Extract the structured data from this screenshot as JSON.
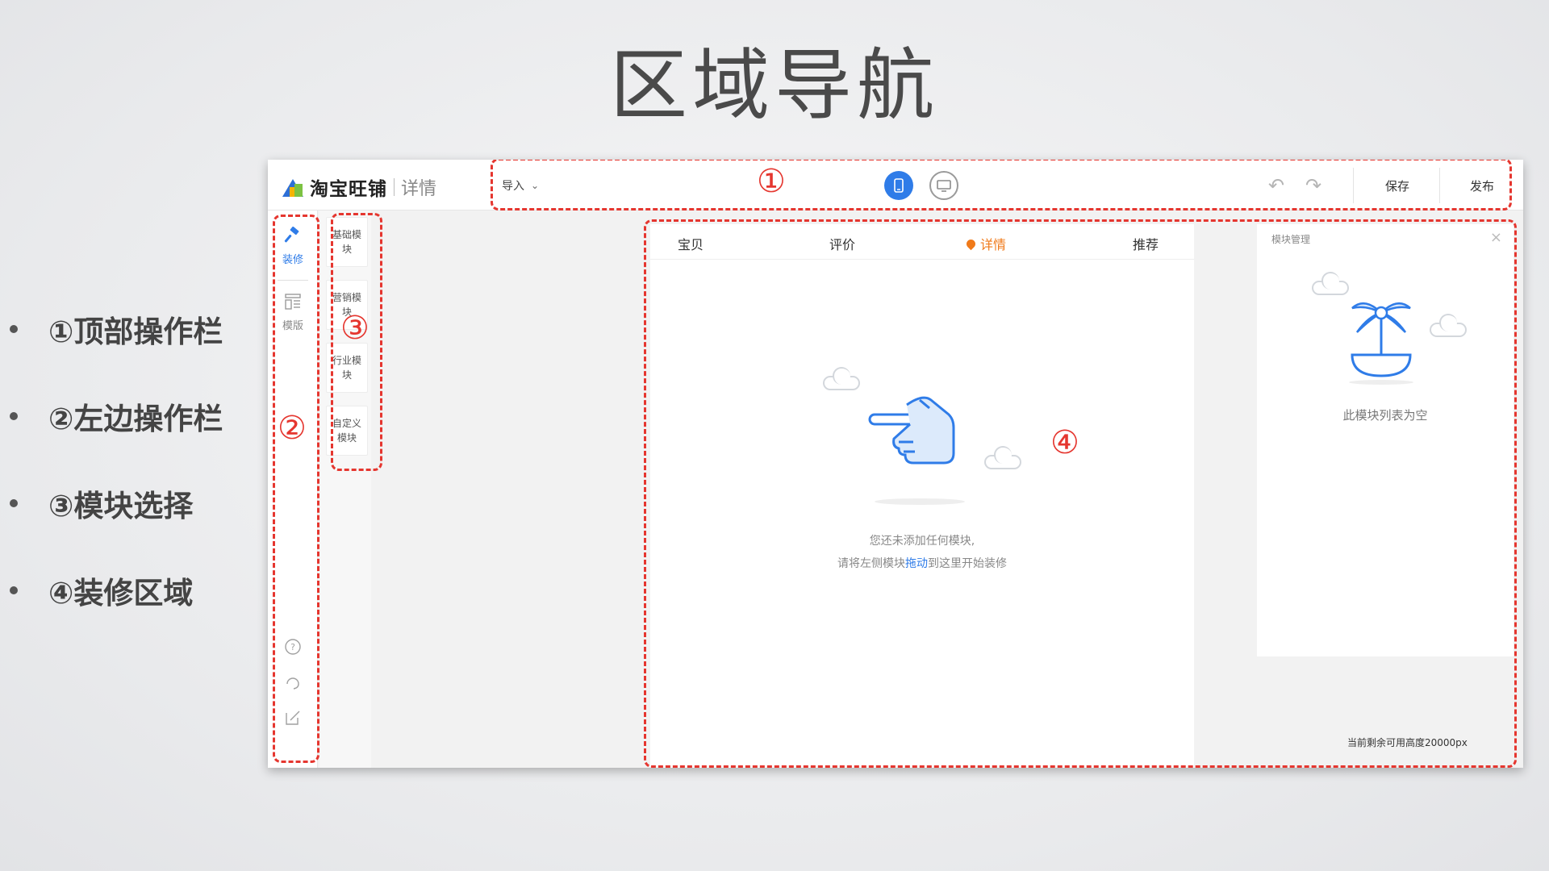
{
  "slide": {
    "title": "区域导航",
    "bullets": [
      "①顶部操作栏",
      "②左边操作栏",
      "③模块选择",
      "④装修区域"
    ]
  },
  "topbar": {
    "logo_text": "淘宝旺铺",
    "logo_sub": "详情",
    "import_label": "导入",
    "save_label": "保存",
    "publish_label": "发布"
  },
  "leftnav": {
    "decorate_label": "装修",
    "template_label": "模版"
  },
  "modules": [
    {
      "label": "基础模块"
    },
    {
      "label": "营销模块"
    },
    {
      "label": "行业模块"
    },
    {
      "label": "自定义模块"
    }
  ],
  "page_tabs": [
    {
      "label": "宝贝"
    },
    {
      "label": "评价"
    },
    {
      "label": "详情"
    },
    {
      "label": "推荐"
    }
  ],
  "canvas": {
    "empty_line1": "您还未添加任何模块,",
    "empty_line2_pre": "请将左侧模块",
    "empty_line2_link": "拖动",
    "empty_line2_post": "到这里开始装修"
  },
  "panel": {
    "title": "模块管理",
    "empty_text": "此模块列表为空"
  },
  "height_info": "当前剩余可用高度20000px",
  "annotations": {
    "n1": "①",
    "n2": "②",
    "n3": "③",
    "n4": "④"
  },
  "colors": {
    "accent_blue": "#2f7ce8",
    "active_orange": "#f07a1a",
    "annotation_red": "#e5362f"
  },
  "icons": {
    "device_mobile": "mobile-icon",
    "device_pc": "monitor-icon",
    "undo": "undo-icon",
    "redo": "redo-icon",
    "help": "help-icon",
    "support": "headset-icon",
    "feedback": "edit-icon"
  }
}
